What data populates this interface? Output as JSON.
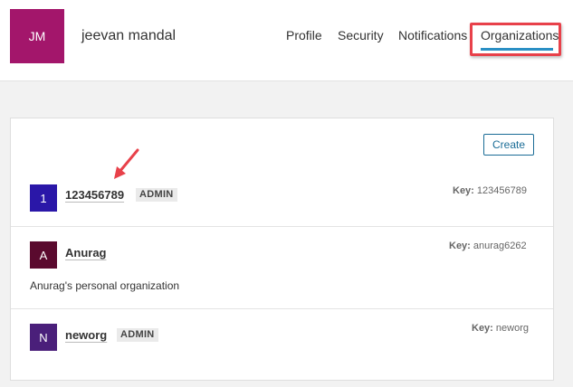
{
  "user": {
    "initials": "JM",
    "name": "jeevan mandal",
    "avatar_color": "#a3166b"
  },
  "nav": {
    "profile": "Profile",
    "security": "Security",
    "notifications": "Notifications",
    "organizations": "Organizations"
  },
  "colors": {
    "accent": "#2a8fc4",
    "highlight": "#e8414a"
  },
  "create_label": "Create",
  "key_label": "Key:",
  "organizations": [
    {
      "initial": "1",
      "name": "123456789",
      "badge": "ADMIN",
      "key": "123456789",
      "avatar_color": "#2a17a8",
      "description": ""
    },
    {
      "initial": "A",
      "name": "Anurag",
      "badge": "",
      "key": "anurag6262",
      "avatar_color": "#5a0a2e",
      "description": "Anurag's personal organization"
    },
    {
      "initial": "N",
      "name": "neworg",
      "badge": "ADMIN",
      "key": "neworg",
      "avatar_color": "#4a1f7a",
      "description": ""
    }
  ]
}
